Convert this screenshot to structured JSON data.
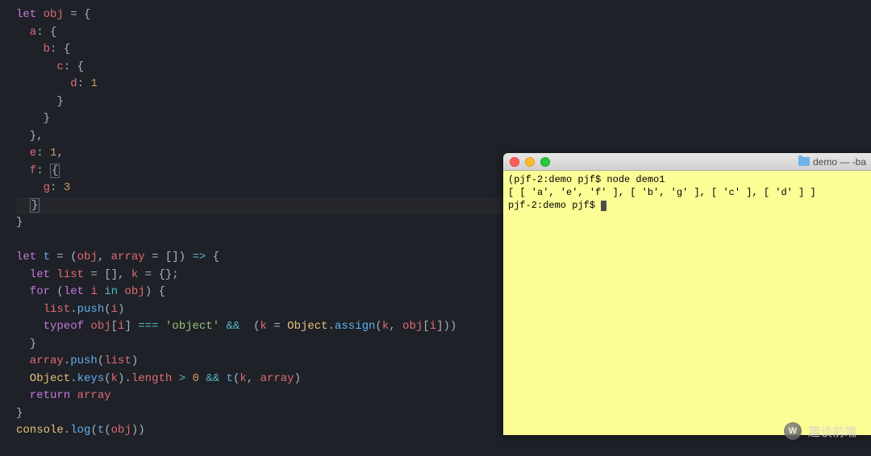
{
  "editor": {
    "lines": [
      [
        [
          "k-let",
          "let "
        ],
        [
          "k-var",
          "obj"
        ],
        [
          "k-punc",
          " = {"
        ]
      ],
      [
        [
          "k-prop",
          "  a"
        ],
        [
          "k-punc",
          ": {"
        ]
      ],
      [
        [
          "k-prop",
          "    b"
        ],
        [
          "k-punc",
          ": {"
        ]
      ],
      [
        [
          "k-prop",
          "      c"
        ],
        [
          "k-punc",
          ": {"
        ]
      ],
      [
        [
          "k-prop",
          "        d"
        ],
        [
          "k-punc",
          ": "
        ],
        [
          "k-num",
          "1"
        ]
      ],
      [
        [
          "k-punc",
          "      }"
        ]
      ],
      [
        [
          "k-punc",
          "    }"
        ]
      ],
      [
        [
          "k-punc",
          "  },"
        ]
      ],
      [
        [
          "k-prop",
          "  e"
        ],
        [
          "k-punc",
          ": "
        ],
        [
          "k-num",
          "1"
        ],
        [
          "k-punc",
          ","
        ]
      ],
      [
        [
          "k-prop",
          "  f"
        ],
        [
          "k-punc",
          ": "
        ],
        [
          "bracket-box",
          "{"
        ]
      ],
      [
        [
          "k-prop",
          "    g"
        ],
        [
          "k-punc",
          ": "
        ],
        [
          "k-num",
          "3"
        ]
      ],
      [
        [
          "bracket-box",
          "  }"
        ]
      ],
      [
        [
          "k-punc",
          "}"
        ]
      ],
      [],
      [
        [
          "k-let",
          "let "
        ],
        [
          "k-fn",
          "t"
        ],
        [
          "k-punc",
          " = ("
        ],
        [
          "k-var",
          "obj"
        ],
        [
          "k-punc",
          ", "
        ],
        [
          "k-var",
          "array"
        ],
        [
          "k-punc",
          " = []) "
        ],
        [
          "k-op",
          "=>"
        ],
        [
          "k-punc",
          " {"
        ]
      ],
      [
        [
          "k-let",
          "  let "
        ],
        [
          "k-var",
          "list"
        ],
        [
          "k-punc",
          " = [], "
        ],
        [
          "k-var",
          "k"
        ],
        [
          "k-punc",
          " = {};"
        ]
      ],
      [
        [
          "k-let",
          "  for "
        ],
        [
          "k-punc",
          "("
        ],
        [
          "k-let",
          "let "
        ],
        [
          "k-var",
          "i"
        ],
        [
          "k-punc",
          " "
        ],
        [
          "k-op",
          "in"
        ],
        [
          "k-punc",
          " "
        ],
        [
          "k-var",
          "obj"
        ],
        [
          "k-punc",
          ") {"
        ]
      ],
      [
        [
          "k-var",
          "    list"
        ],
        [
          "k-punc",
          "."
        ],
        [
          "k-fn",
          "push"
        ],
        [
          "k-punc",
          "("
        ],
        [
          "k-var",
          "i"
        ],
        [
          "k-punc",
          ")"
        ]
      ],
      [
        [
          "k-type",
          "    typeof "
        ],
        [
          "k-var",
          "obj"
        ],
        [
          "k-punc",
          "["
        ],
        [
          "k-var",
          "i"
        ],
        [
          "k-punc",
          "] "
        ],
        [
          "k-op",
          "==="
        ],
        [
          "k-punc",
          " "
        ],
        [
          "k-str",
          "'object'"
        ],
        [
          "k-punc",
          " "
        ],
        [
          "k-op",
          "&&"
        ],
        [
          "k-punc",
          "  ("
        ],
        [
          "k-var",
          "k"
        ],
        [
          "k-punc",
          " = "
        ],
        [
          "k-obj",
          "Object"
        ],
        [
          "k-punc",
          "."
        ],
        [
          "k-fn",
          "assign"
        ],
        [
          "k-punc",
          "("
        ],
        [
          "k-var",
          "k"
        ],
        [
          "k-punc",
          ", "
        ],
        [
          "k-var",
          "obj"
        ],
        [
          "k-punc",
          "["
        ],
        [
          "k-var",
          "i"
        ],
        [
          "k-punc",
          "]))"
        ]
      ],
      [
        [
          "k-punc",
          "  }"
        ]
      ],
      [
        [
          "k-var",
          "  array"
        ],
        [
          "k-punc",
          "."
        ],
        [
          "k-fn",
          "push"
        ],
        [
          "k-punc",
          "("
        ],
        [
          "k-var",
          "list"
        ],
        [
          "k-punc",
          ")"
        ]
      ],
      [
        [
          "k-obj",
          "  Object"
        ],
        [
          "k-punc",
          "."
        ],
        [
          "k-fn",
          "keys"
        ],
        [
          "k-punc",
          "("
        ],
        [
          "k-var",
          "k"
        ],
        [
          "k-punc",
          ")."
        ],
        [
          "k-var",
          "length"
        ],
        [
          "k-punc",
          " "
        ],
        [
          "k-op",
          ">"
        ],
        [
          "k-punc",
          " "
        ],
        [
          "k-num",
          "0"
        ],
        [
          "k-punc",
          " "
        ],
        [
          "k-op",
          "&&"
        ],
        [
          "k-punc",
          " "
        ],
        [
          "k-fn",
          "t"
        ],
        [
          "k-punc",
          "("
        ],
        [
          "k-var",
          "k"
        ],
        [
          "k-punc",
          ", "
        ],
        [
          "k-var",
          "array"
        ],
        [
          "k-punc",
          ")"
        ]
      ],
      [
        [
          "k-let",
          "  return "
        ],
        [
          "k-var",
          "array"
        ]
      ],
      [
        [
          "k-punc",
          "}"
        ]
      ],
      [
        [
          "k-obj",
          "console"
        ],
        [
          "k-punc",
          "."
        ],
        [
          "k-fn",
          "log"
        ],
        [
          "k-punc",
          "("
        ],
        [
          "k-fn",
          "t"
        ],
        [
          "k-punc",
          "("
        ],
        [
          "k-var",
          "obj"
        ],
        [
          "k-punc",
          "))"
        ]
      ]
    ],
    "highlight": 11
  },
  "terminal": {
    "title": "demo — -ba",
    "lines": [
      "(pjf-2:demo pjf$ node demo1",
      "[ [ 'a', 'e', 'f' ], [ 'b', 'g' ], [ 'c' ], [ 'd' ] ]",
      "pjf-2:demo pjf$ "
    ]
  },
  "watermark": {
    "icon": "W",
    "text": "趣谈前端"
  }
}
